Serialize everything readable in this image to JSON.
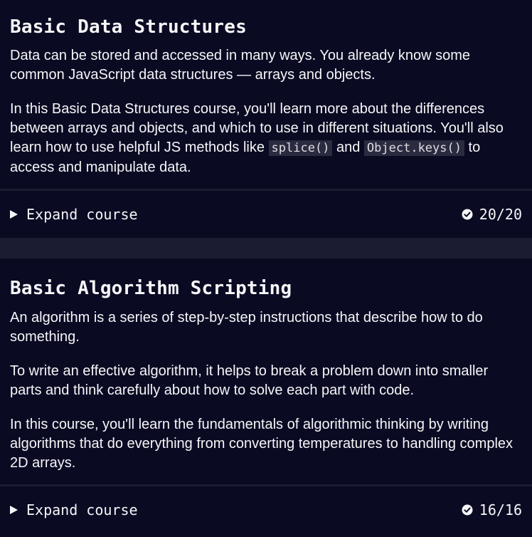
{
  "courses": [
    {
      "title": "Basic Data Structures",
      "p1": "Data can be stored and accessed in many ways. You already know some common JavaScript data structures — arrays and objects.",
      "p2_a": "In this Basic Data Structures course, you'll learn more about the differences between arrays and objects, and which to use in different situations. You'll also learn how to use helpful JS methods like ",
      "p2_code1": "splice()",
      "p2_b": " and ",
      "p2_code2": "Object.keys()",
      "p2_c": " to access and manipulate data.",
      "expand_label": "Expand course",
      "progress": "20/20"
    },
    {
      "title": "Basic Algorithm Scripting",
      "p1": "An algorithm is a series of step-by-step instructions that describe how to do something.",
      "p2": "To write an effective algorithm, it helps to break a problem down into smaller parts and think carefully about how to solve each part with code.",
      "p3": "In this course, you'll learn the fundamentals of algorithmic thinking by writing algorithms that do everything from converting temperatures to handling complex 2D arrays.",
      "expand_label": "Expand course",
      "progress": "16/16"
    }
  ],
  "icons": {
    "expand": "caret-right-icon",
    "complete": "check-circle-icon"
  },
  "colors": {
    "background": "#0a0a23",
    "band": "#1b1b32",
    "text": "#f5f6f7",
    "code_bg": "#2a2a40"
  }
}
